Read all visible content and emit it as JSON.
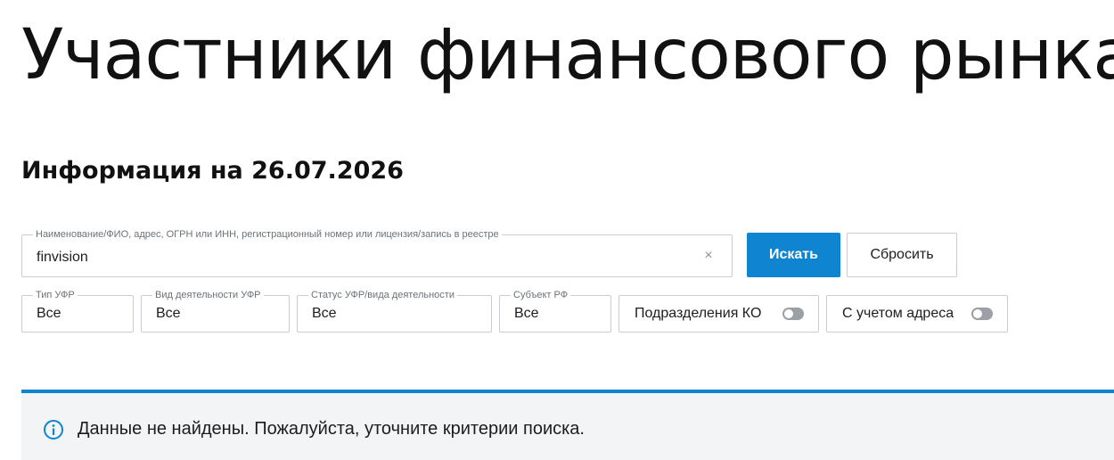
{
  "page": {
    "title": "Участники финансового рынка",
    "info_date": "Информация на 26.07.2026"
  },
  "search": {
    "label": "Наименование/ФИО, адрес, ОГРН или ИНН, регистрационный номер или лицензия/запись в реестре",
    "value": "finvision",
    "clear_glyph": "×",
    "submit_label": "Искать",
    "reset_label": "Сбросить"
  },
  "filters": [
    {
      "label": "Тип УФР",
      "value": "Все"
    },
    {
      "label": "Вид деятельности УФР",
      "value": "Все"
    },
    {
      "label": "Статус УФР/вида деятельности",
      "value": "Все"
    },
    {
      "label": "Субъект РФ",
      "value": "Все"
    }
  ],
  "toggles": [
    {
      "label": "Подразделения КО",
      "on": false
    },
    {
      "label": "С учетом адреса",
      "on": false
    }
  ],
  "notice": {
    "icon": "info-icon",
    "text": "Данные не найдены. Пожалуйста, уточните критерии поиска."
  },
  "colors": {
    "accent": "#0f84d0",
    "notice_bg": "#f2f4f5",
    "border": "#c8cdd2",
    "switch_off": "#9aa0a6"
  }
}
